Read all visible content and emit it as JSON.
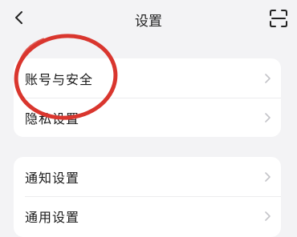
{
  "header": {
    "title": "设置",
    "back_icon": "chevron-left-icon",
    "scan_icon": "scan-icon"
  },
  "groups": [
    {
      "items": [
        {
          "label": "账号与安全"
        },
        {
          "label": "隐私设置"
        }
      ]
    },
    {
      "items": [
        {
          "label": "通知设置"
        },
        {
          "label": "通用设置"
        }
      ]
    }
  ],
  "annotation": {
    "color": "#d9362e",
    "shape": "circle"
  },
  "colors": {
    "background": "#f3f3f5",
    "card": "#ffffff",
    "chevron": "#c4c4c8"
  }
}
